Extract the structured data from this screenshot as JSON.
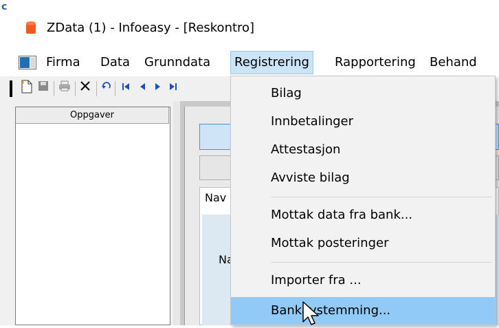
{
  "window": {
    "title": "ZData (1) - Infoeasy - [Reskontro]",
    "corner_glyph": "c"
  },
  "menubar": {
    "items": [
      {
        "label": "Firma"
      },
      {
        "label": "Data"
      },
      {
        "label": "Grunndata"
      },
      {
        "label": "Registrering",
        "active": true
      },
      {
        "label": "Rapportering"
      },
      {
        "label": "Behand"
      }
    ]
  },
  "toolbar": {
    "icons": [
      "new-document-icon",
      "save-icon",
      "print-icon",
      "delete-icon",
      "undo-icon",
      "first-record-icon",
      "previous-record-icon",
      "next-record-icon",
      "last-record-icon"
    ]
  },
  "left_panel": {
    "header": "Oppgaver"
  },
  "main": {
    "tab_label": "Nav",
    "field_label": "Na"
  },
  "dropdown": {
    "items": [
      {
        "label": "Bilag"
      },
      {
        "label": "Innbetalinger"
      },
      {
        "label": "Attestasjon"
      },
      {
        "label": "Avviste bilag"
      },
      {
        "label": "Mottak data fra bank..."
      },
      {
        "label": "Mottak posteringer"
      },
      {
        "label": "Importer fra ..."
      },
      {
        "label": "Bankavstemming...",
        "highlighted": true
      }
    ]
  },
  "colors": {
    "menu_active_bg": "#cce4f7",
    "dropdown_highlight": "#91c9f7",
    "app_icon": "#f05a22"
  }
}
